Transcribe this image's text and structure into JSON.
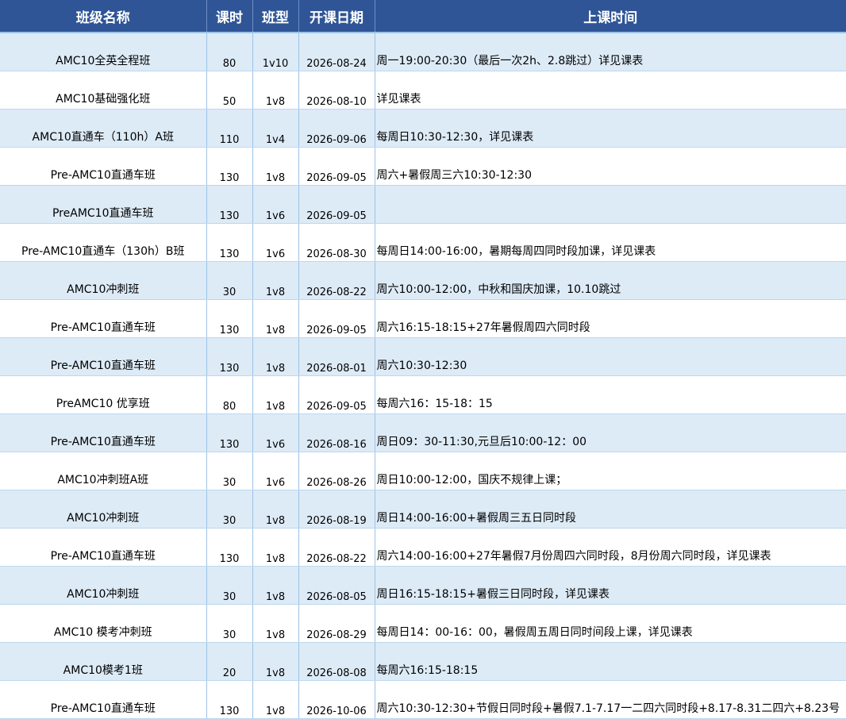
{
  "headers": [
    "班级名称",
    "课时",
    "班型",
    "开课日期",
    "上课时间"
  ],
  "rows": [
    {
      "name": "AMC10全英全程班",
      "hours": "80",
      "type": "1v10",
      "date": "2026-08-24",
      "time": "周一19:00-20:30（最后一次2h、2.8跳过）详见课表"
    },
    {
      "name": "AMC10基础强化班",
      "hours": "50",
      "type": "1v8",
      "date": "2026-08-10",
      "time": "详见课表"
    },
    {
      "name": "AMC10直通车（110h）A班",
      "hours": "110",
      "type": "1v4",
      "date": "2026-09-06",
      "time": "每周日10:30-12:30，详见课表"
    },
    {
      "name": "Pre-AMC10直通车班",
      "hours": "130",
      "type": "1v8",
      "date": "2026-09-05",
      "time": "周六+暑假周三六10:30-12:30"
    },
    {
      "name": "PreAMC10直通车班",
      "hours": "130",
      "type": "1v6",
      "date": "2026-09-05",
      "time": ""
    },
    {
      "name": "Pre-AMC10直通车（130h）B班",
      "hours": "130",
      "type": "1v6",
      "date": "2026-08-30",
      "time": "每周日14:00-16:00，暑期每周四同时段加课，详见课表"
    },
    {
      "name": "AMC10冲刺班",
      "hours": "30",
      "type": "1v8",
      "date": "2026-08-22",
      "time": "周六10:00-12:00，中秋和国庆加课，10.10跳过"
    },
    {
      "name": "Pre-AMC10直通车班",
      "hours": "130",
      "type": "1v8",
      "date": "2026-09-05",
      "time": "周六16:15-18:15+27年暑假周四六同时段"
    },
    {
      "name": "Pre-AMC10直通车班",
      "hours": "130",
      "type": "1v8",
      "date": "2026-08-01",
      "time": "周六10:30-12:30"
    },
    {
      "name": "PreAMC10 优享班",
      "hours": "80",
      "type": "1v8",
      "date": "2026-09-05",
      "time": "每周六16：15-18：15"
    },
    {
      "name": "Pre-AMC10直通车班",
      "hours": "130",
      "type": "1v6",
      "date": "2026-08-16",
      "time": "周日09：30-11:30,元旦后10:00-12：00"
    },
    {
      "name": "AMC10冲刺班A班",
      "hours": "30",
      "type": "1v6",
      "date": "2026-08-26",
      "time": "周日10:00-12:00，国庆不规律上课；"
    },
    {
      "name": "AMC10冲刺班",
      "hours": "30",
      "type": "1v8",
      "date": "2026-08-19",
      "time": "周日14:00-16:00+暑假周三五日同时段"
    },
    {
      "name": "Pre-AMC10直通车班",
      "hours": "130",
      "type": "1v8",
      "date": "2026-08-22",
      "time": "周六14:00-16:00+27年暑假7月份周四六同时段，8月份周六同时段，详见课表"
    },
    {
      "name": "AMC10冲刺班",
      "hours": "30",
      "type": "1v8",
      "date": "2026-08-05",
      "time": "周日16:15-18:15+暑假三日同时段，详见课表"
    },
    {
      "name": "AMC10 模考冲刺班",
      "hours": "30",
      "type": "1v8",
      "date": "2026-08-29",
      "time": "每周日14：00-16：00，暑假周五周日同时间段上课，详见课表"
    },
    {
      "name": "AMC10模考1班",
      "hours": "20",
      "type": "1v8",
      "date": "2026-08-08",
      "time": "每周六16:15-18:15"
    },
    {
      "name": "Pre-AMC10直通车班",
      "hours": "130",
      "type": "1v8",
      "date": "2026-10-06",
      "time": "周六10:30-12:30+节假日同时段+暑假7.1-7.17一二四六同时段+8.17-8.31二四六+8.23号"
    }
  ]
}
